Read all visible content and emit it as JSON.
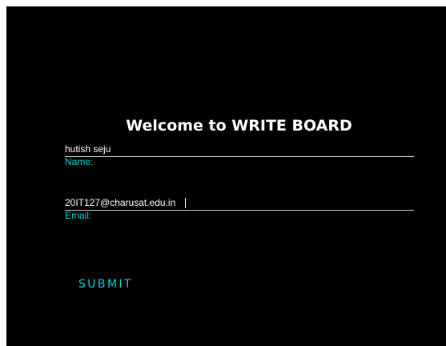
{
  "page": {
    "title": "Welcome to WRITE BOARD"
  },
  "form": {
    "name": {
      "value": "hutish seju",
      "label": "Name:"
    },
    "email": {
      "value": "20IT127@charusat.edu.in",
      "label": "Email:"
    },
    "submit_label": "SUBMIT"
  },
  "colors": {
    "background": "#000000",
    "accent": "#00d5dc",
    "text": "#ffffff",
    "underline": "#c8c8c8"
  }
}
